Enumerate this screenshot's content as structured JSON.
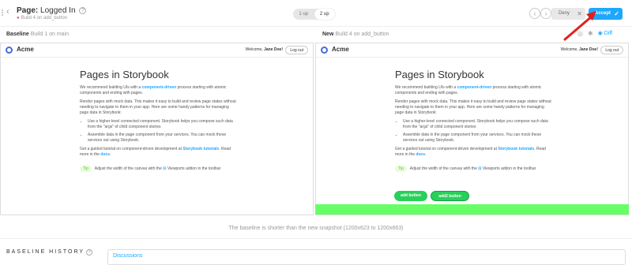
{
  "header": {
    "title_prefix": "Page:",
    "title_name": "Logged In",
    "help_icon": "?",
    "subtitle": "Build 4 on add_button",
    "view_toggle": [
      "1 up",
      "2 up"
    ],
    "deny_label": "Deny",
    "accept_label": "Accept"
  },
  "compare": {
    "baseline_label": "Baseline",
    "baseline_build": "Build 1 on main",
    "new_label": "New",
    "new_build": "Build 4 on add_button",
    "diff_label": "Diff"
  },
  "app": {
    "brand": "Acme",
    "welcome_prefix": "Welcome, ",
    "user": "Jane Doe!",
    "logout": "Log out",
    "heading": "Pages in Storybook",
    "p1_pre": "We recommend building UIs with a ",
    "p1_link": "component-driven",
    "p1_post": " process starting with atomic components and ending with pages.",
    "p2": "Render pages with mock data. This makes it easy to build and review page states without needing to navigate to them in your app. Here are some handy patterns for managing page data in Storybook:",
    "li1": "Use a higher-level connected component. Storybook helps you compose such data from the \"args\" of child component stories",
    "li2": "Assemble data in the page component from your services. You can mock these services out using Storybook.",
    "p3_pre": "Get a guided tutorial on component-driven development at ",
    "p3_link": "Storybook tutorials",
    "p3_mid": ". Read more in the ",
    "p3_link2": "docs",
    "p3_post": ".",
    "tip_badge": "Tip",
    "tip_text": "Adjust the width of the canvas with the",
    "tip_text2": "Viewports addon in the toolbar",
    "btn_add": "add button",
    "btn_add2": "add2 button"
  },
  "footer": {
    "notice": "The baseline is shorter than the new snapshot (1200x623 to 1200x663)",
    "history": "BASELINE HISTORY",
    "discussions": "Discussions"
  },
  "colors": {
    "accent": "#1ea7fd",
    "green": "#27d05a",
    "diff_band": "#66ff66",
    "annotation_arrow": "#e02020"
  }
}
